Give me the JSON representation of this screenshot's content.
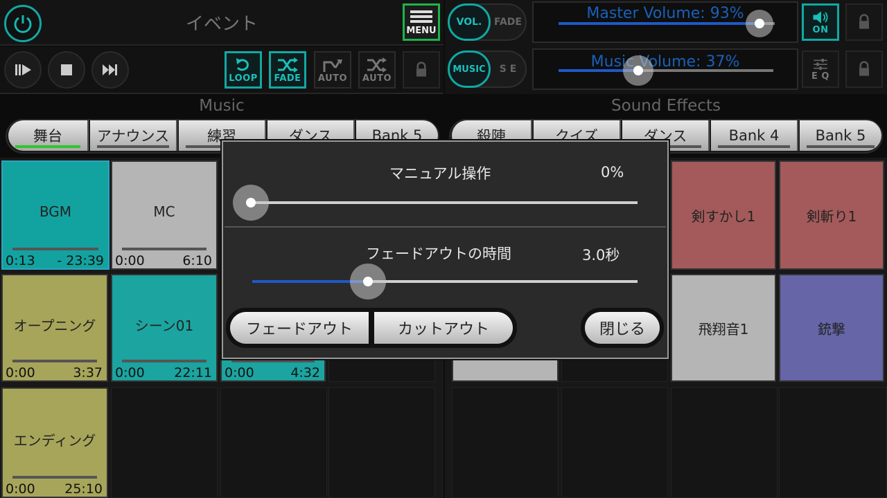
{
  "header": {
    "title": "イベント",
    "menu_label": "MENU"
  },
  "transport": {
    "loop_label": "LOOP",
    "fade_label": "FADE",
    "auto1_label": "AUTO",
    "auto2_label": "AUTO"
  },
  "right_header": {
    "vol_label": "VOL.",
    "fade_label": "FADE",
    "music_label": "MUSIC",
    "se_label": "S E",
    "master_volume_label": "Master Volume: 93%",
    "master_volume_value": 93,
    "music_volume_label": "Music Volume: 37%",
    "music_volume_value": 37,
    "speaker_on_label": "ON",
    "eq_label": "E Q"
  },
  "music": {
    "section_label": "Music",
    "banks": [
      "舞台",
      "アナウンス",
      "練習",
      "ダンス",
      "Bank 5"
    ],
    "active_bank": 0,
    "pads": [
      {
        "name": "BGM",
        "start": "0:13",
        "end": "- 23:39",
        "color": "#12a3a0"
      },
      {
        "name": "MC",
        "start": "0:00",
        "end": "6:10",
        "color": "#b5b5b5"
      },
      {
        "name": "",
        "start": "",
        "end": "",
        "color": ""
      },
      {
        "name": "",
        "start": "",
        "end": "",
        "color": ""
      },
      {
        "name": "オープニング",
        "start": "0:00",
        "end": "3:37",
        "color": "#a7a55a"
      },
      {
        "name": "シーン01",
        "start": "0:00",
        "end": "22:11",
        "color": "#1ba4a0"
      },
      {
        "name": "",
        "start": "0:00",
        "end": "4:32",
        "color": "#1ba4a0"
      },
      {
        "name": "",
        "start": "",
        "end": "",
        "color": ""
      },
      {
        "name": "エンディング",
        "start": "0:00",
        "end": "25:10",
        "color": "#a7a55a"
      }
    ]
  },
  "sound_effects": {
    "section_label": "Sound Effects",
    "banks": [
      "殺陣",
      "クイズ",
      "ダンス",
      "Bank 4",
      "Bank 5"
    ],
    "pads": [
      {
        "name": "剣すかし1",
        "color": "#a45a5a"
      },
      {
        "name": "剣斬り1",
        "color": "#a45a5a"
      },
      {
        "name": "飛翔音1",
        "color": "#b5b5b5"
      },
      {
        "name": "銃撃",
        "color": "#6565a8"
      }
    ]
  },
  "dialog": {
    "manual_label": "マニュアル操作",
    "manual_value": "0%",
    "manual_level": 0,
    "fade_time_label": "フェードアウトの時間",
    "fade_time_value": "3.0秒",
    "fade_time_level": 0.3,
    "fadeout_button": "フェードアウト",
    "cutout_button": "カットアウト",
    "close_button": "閉じる"
  }
}
